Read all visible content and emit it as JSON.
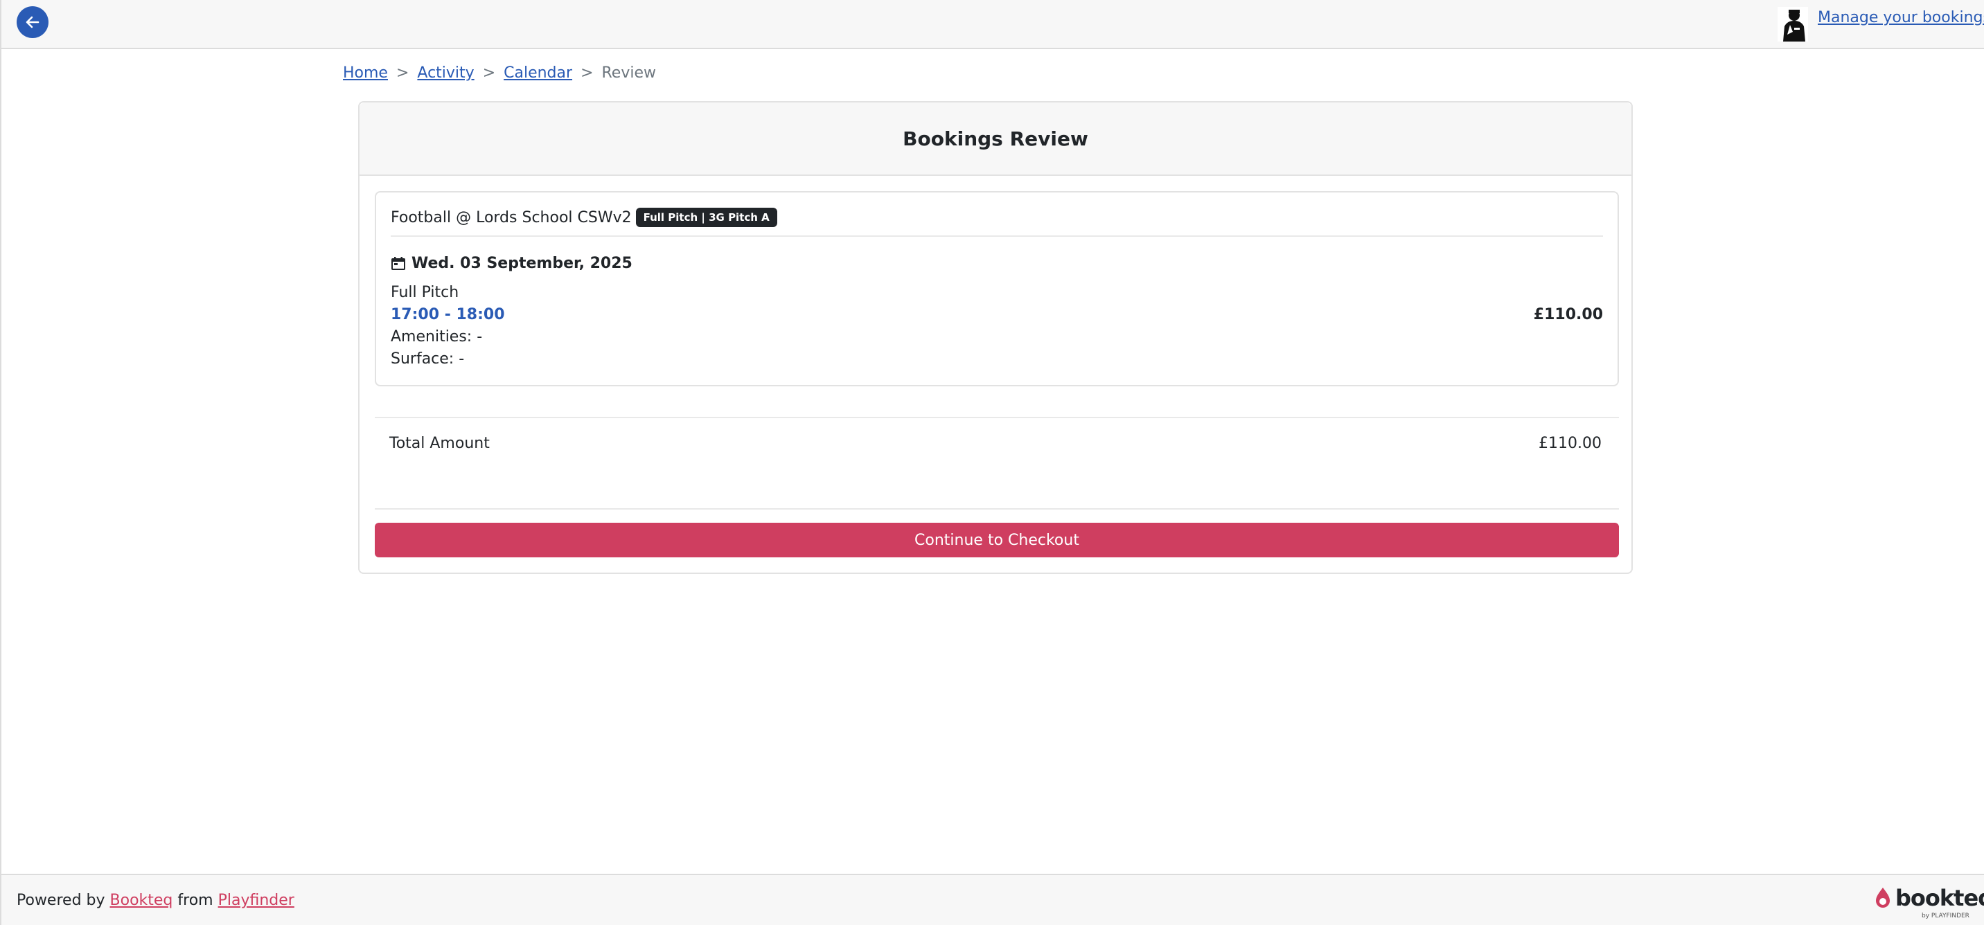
{
  "topbar": {
    "manage_link": "Manage your bookings"
  },
  "breadcrumb": {
    "items": [
      {
        "label": "Home"
      },
      {
        "label": "Activity"
      },
      {
        "label": "Calendar"
      }
    ],
    "separator": ">",
    "current": "Review"
  },
  "card": {
    "title": "Bookings Review",
    "booking": {
      "title": "Football @ Lords School CSWv2",
      "badge": "Full Pitch | 3G Pitch A",
      "date": "Wed. 03 September, 2025",
      "slot_name": "Full Pitch",
      "time": "17:00 - 18:00",
      "price": "£110.00",
      "amenities": "Amenities:  -",
      "surface": "Surface:  -"
    },
    "total_label": "Total Amount",
    "total_value": "£110.00",
    "checkout_label": "Continue to Checkout"
  },
  "footer": {
    "powered_by": "Powered by",
    "bookteq_link": "Bookteq",
    "from": "from",
    "playfinder_link": "Playfinder",
    "logo_word": "bookteq",
    "logo_sub": "by PLAYFINDER"
  },
  "colors": {
    "accent_blue": "#2a5bb5",
    "brand_pink": "#cf3e60"
  },
  "icons": [
    "arrow-left-icon",
    "user-avatar",
    "calendar-icon",
    "bookteq-logo-icon"
  ]
}
